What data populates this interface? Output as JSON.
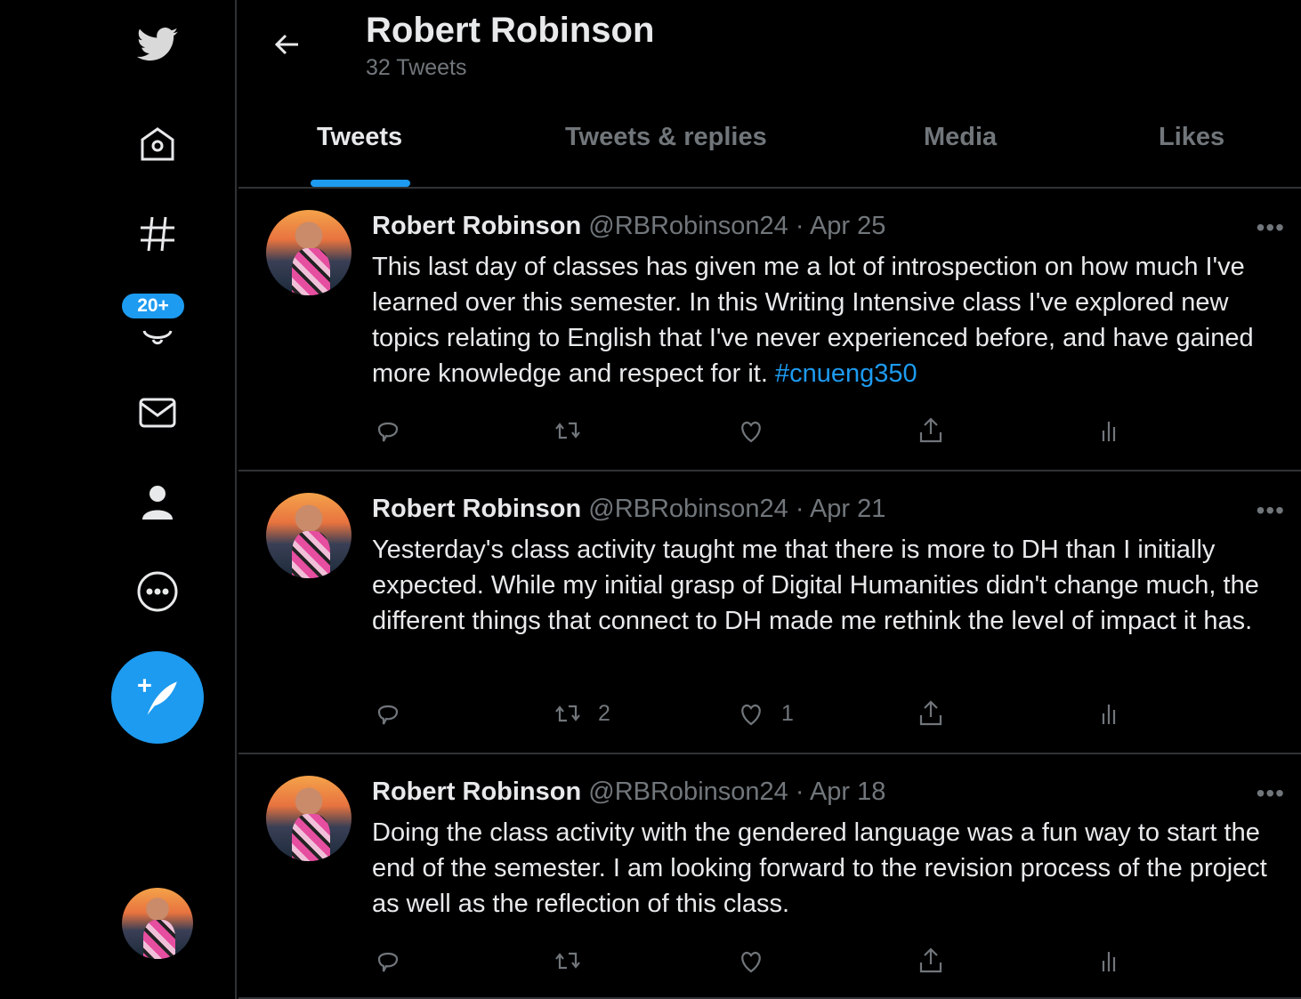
{
  "sidebar": {
    "notifications_badge": "20+",
    "icons": [
      "twitter-logo-icon",
      "home-icon",
      "explore-hashtag-icon",
      "notifications-bell-icon",
      "messages-envelope-icon",
      "profile-icon",
      "more-icon",
      "compose-tweet-icon"
    ]
  },
  "header": {
    "title": "Robert Robinson",
    "subtitle": "32 Tweets"
  },
  "tabs": [
    {
      "label": "Tweets"
    },
    {
      "label": "Tweets & replies"
    },
    {
      "label": "Media"
    },
    {
      "label": "Likes"
    }
  ],
  "colors": {
    "accent": "#1d9bf0",
    "background": "#000000",
    "muted": "#71767b"
  },
  "tweets": [
    {
      "name": "Robert Robinson",
      "handle": "@RBRobinson24",
      "date": "Apr 25",
      "text": "This last day of classes has given me a lot of introspection on how much I've learned over this semester. In this Writing Intensive class I've explored new topics relating to English that I've never experienced before, and have gained more knowledge and respect for it. ",
      "hashtag": "#cnueng350",
      "retweets": "",
      "likes": ""
    },
    {
      "name": "Robert Robinson",
      "handle": "@RBRobinson24",
      "date": "Apr 21",
      "text": "Yesterday's class activity taught me that there is more to DH than I initially expected. While my initial grasp of Digital Humanities didn't change much, the different things that connect to DH made me rethink the level of impact it has.",
      "hashtag": "",
      "retweets": "2",
      "likes": "1"
    },
    {
      "name": "Robert Robinson",
      "handle": "@RBRobinson24",
      "date": "Apr 18",
      "text": "Doing the class activity with the gendered language was a fun way to start the end of the semester. I am looking forward to the revision process of the project as well as the reflection of this class.",
      "hashtag": "",
      "retweets": "",
      "likes": ""
    }
  ]
}
